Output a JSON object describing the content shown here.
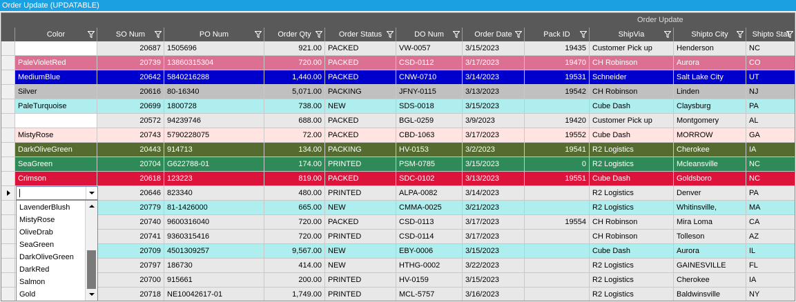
{
  "window": {
    "title": "Order Update (UPDATABLE)"
  },
  "grid": {
    "band_title": "Order Update",
    "columns": [
      {
        "key": "color",
        "label": "Color"
      },
      {
        "key": "so",
        "label": "SO Num"
      },
      {
        "key": "po",
        "label": "PO Num"
      },
      {
        "key": "qty",
        "label": "Order Qty"
      },
      {
        "key": "status",
        "label": "Order Status"
      },
      {
        "key": "do",
        "label": "DO Num"
      },
      {
        "key": "date",
        "label": "Order Date"
      },
      {
        "key": "pack",
        "label": "Pack ID"
      },
      {
        "key": "ship",
        "label": "ShipVia"
      },
      {
        "key": "city",
        "label": "Shipto City"
      },
      {
        "key": "state",
        "label": "Shipto Stat"
      }
    ],
    "rows": [
      {
        "color": "",
        "so": "20687",
        "po": "1505696",
        "qty": "921.00",
        "status": "PACKED",
        "do": "VW-0057",
        "date": "3/15/2023",
        "pack": "19435",
        "ship": "Customer Pick up",
        "city": "Henderson",
        "state": "NC",
        "bg": "#e8e8e8",
        "fg": "#000000"
      },
      {
        "color": "PaleVioletRed",
        "so": "20739",
        "po": "13860315304",
        "qty": "720.00",
        "status": "PACKED",
        "do": "CSD-0112",
        "date": "3/17/2023",
        "pack": "19470",
        "ship": "CH Robinson",
        "city": "Aurora",
        "state": "CO",
        "bg": "#db7093",
        "fg": "#ffffff"
      },
      {
        "color": "MediumBlue",
        "so": "20642",
        "po": "5840216288",
        "qty": "1,440.00",
        "status": "PACKED",
        "do": "CNW-0710",
        "date": "3/14/2023",
        "pack": "19531",
        "ship": "Schneider",
        "city": "Salt Lake City",
        "state": "UT",
        "bg": "#0000cd",
        "fg": "#ffffff"
      },
      {
        "color": "Silver",
        "so": "20616",
        "po": "80-16340",
        "qty": "5,071.00",
        "status": "PACKING",
        "do": "JFNY-0115",
        "date": "3/13/2023",
        "pack": "19542",
        "ship": "CH Robinson",
        "city": "Linden",
        "state": "NJ",
        "bg": "#c0c0c0",
        "fg": "#000000"
      },
      {
        "color": "PaleTurquoise",
        "so": "20699",
        "po": "1800728",
        "qty": "738.00",
        "status": "NEW",
        "do": "SDS-0018",
        "date": "3/15/2023",
        "pack": "",
        "ship": "Cube Dash",
        "city": "Claysburg",
        "state": "PA",
        "bg": "#afeeee",
        "fg": "#000000"
      },
      {
        "color": "",
        "so": "20572",
        "po": "94239746",
        "qty": "688.00",
        "status": "PACKED",
        "do": "BGL-0259",
        "date": "3/9/2023",
        "pack": "19420",
        "ship": "Customer Pick up",
        "city": "Montgomery",
        "state": "AL",
        "bg": "#e8e8e8",
        "fg": "#000000"
      },
      {
        "color": "MistyRose",
        "so": "20743",
        "po": "5790228075",
        "qty": "72.00",
        "status": "PACKED",
        "do": "CBD-1063",
        "date": "3/17/2023",
        "pack": "19552",
        "ship": "Cube Dash",
        "city": "MORROW",
        "state": "GA",
        "bg": "#ffe4e1",
        "fg": "#000000"
      },
      {
        "color": "DarkOliveGreen",
        "so": "20443",
        "po": "914713",
        "qty": "134.00",
        "status": "PACKING",
        "do": "HV-0153",
        "date": "3/2/2023",
        "pack": "19541",
        "ship": "R2 Logistics",
        "city": "Cherokee",
        "state": "IA",
        "bg": "#556b2f",
        "fg": "#ffffff"
      },
      {
        "color": "SeaGreen",
        "so": "20704",
        "po": "G622788-01",
        "qty": "174.00",
        "status": "PRINTED",
        "do": "PSM-0785",
        "date": "3/15/2023",
        "pack": "0",
        "ship": "R2 Logistics",
        "city": "Mcleansville",
        "state": "NC",
        "bg": "#2e8b57",
        "fg": "#ffffff"
      },
      {
        "color": "Crimson",
        "so": "20618",
        "po": "123223",
        "qty": "819.00",
        "status": "PACKED",
        "do": "SDC-0102",
        "date": "3/13/2023",
        "pack": "19551",
        "ship": "Cube Dash",
        "city": "Goldsboro",
        "state": "NC",
        "bg": "#dc143c",
        "fg": "#ffffff"
      },
      {
        "color": "",
        "so": "20646",
        "po": "823340",
        "qty": "480.00",
        "status": "PRINTED",
        "do": "ALPA-0082",
        "date": "3/14/2023",
        "pack": "",
        "ship": "R2 Logistics",
        "city": "Denver",
        "state": "PA",
        "bg": "#e8e8e8",
        "fg": "#000000"
      },
      {
        "color": "",
        "so": "20779",
        "po": "81-1426000",
        "qty": "665.00",
        "status": "NEW",
        "do": "CMMA-0025",
        "date": "3/21/2023",
        "pack": "",
        "ship": "R2 Logistics",
        "city": "Whitinsville,",
        "state": "MA",
        "bg": "#afeeee",
        "fg": "#000000"
      },
      {
        "color": "",
        "so": "20740",
        "po": "9600316040",
        "qty": "720.00",
        "status": "PACKED",
        "do": "CSD-0113",
        "date": "3/17/2023",
        "pack": "19554",
        "ship": "CH Robinson",
        "city": "Mira Loma",
        "state": "CA",
        "bg": "#e8e8e8",
        "fg": "#000000"
      },
      {
        "color": "",
        "so": "20741",
        "po": "9360315416",
        "qty": "720.00",
        "status": "PRINTED",
        "do": "CSD-0114",
        "date": "3/17/2023",
        "pack": "",
        "ship": "CH Robinson",
        "city": "Tolleson",
        "state": "AZ",
        "bg": "#e8e8e8",
        "fg": "#000000"
      },
      {
        "color": "",
        "so": "20709",
        "po": "4501309257",
        "qty": "9,567.00",
        "status": "NEW",
        "do": "EBY-0006",
        "date": "3/15/2023",
        "pack": "",
        "ship": "Cube Dash",
        "city": "Aurora",
        "state": "IL",
        "bg": "#afeeee",
        "fg": "#000000"
      },
      {
        "color": "",
        "so": "20797",
        "po": "186730",
        "qty": "414.00",
        "status": "NEW",
        "do": "HTHG-0002",
        "date": "3/22/2023",
        "pack": "",
        "ship": "R2 Logistics",
        "city": "GAINESVILLE",
        "state": "FL",
        "bg": "#e8e8e8",
        "fg": "#000000"
      },
      {
        "color": "",
        "so": "20700",
        "po": "915661",
        "qty": "200.00",
        "status": "PRINTED",
        "do": "HV-0159",
        "date": "3/15/2023",
        "pack": "",
        "ship": "R2 Logistics",
        "city": "Cherokee",
        "state": "IA",
        "bg": "#e8e8e8",
        "fg": "#000000"
      },
      {
        "color": "",
        "so": "20718",
        "po": "NE10042617-01",
        "qty": "1,749.00",
        "status": "PRINTED",
        "do": "MCL-5757",
        "date": "3/16/2023",
        "pack": "",
        "ship": "R2 Logistics",
        "city": "Baldwinsville",
        "state": "NY",
        "bg": "#e8e8e8",
        "fg": "#000000"
      }
    ],
    "color_cell_white": [
      "#ffffff"
    ],
    "current_row_index": 10,
    "editor": {
      "value": "",
      "options": [
        "LavenderBlush",
        "MistyRose",
        "OliveDrab",
        "SeaGreen",
        "DarkOliveGreen",
        "DarkRed",
        "Salmon",
        "Gold"
      ]
    }
  }
}
